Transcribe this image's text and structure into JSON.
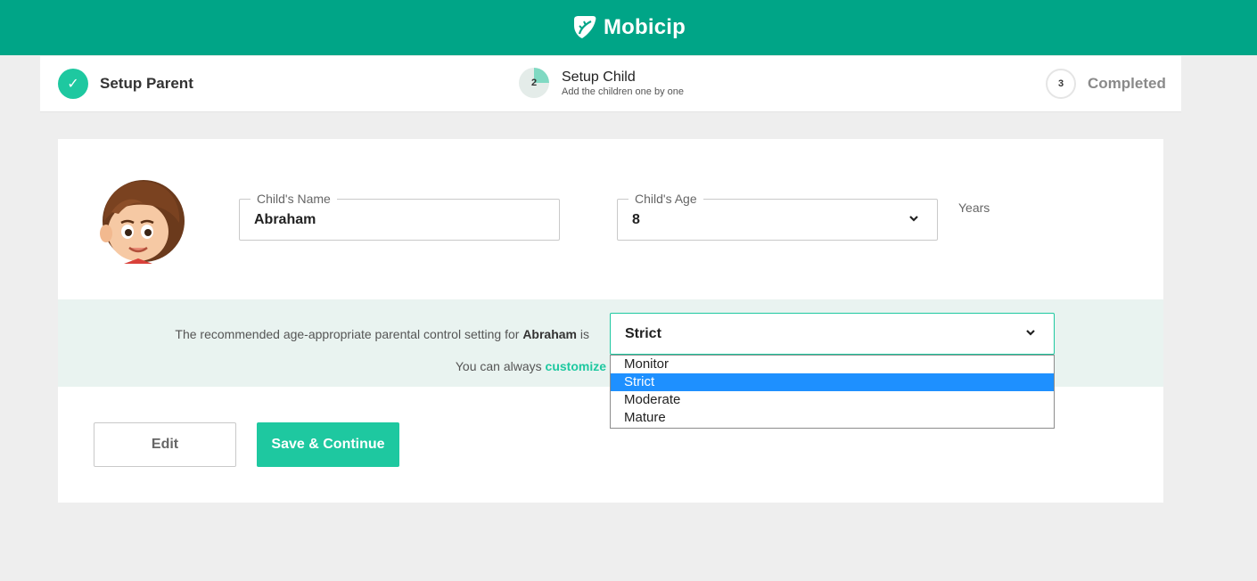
{
  "header": {
    "brand": "Mobicip"
  },
  "steps": [
    {
      "number": "✓",
      "label": "Setup Parent",
      "status": "done"
    },
    {
      "number": "2",
      "label": "Setup Child",
      "subtitle": "Add the children one by one",
      "status": "active",
      "progress": 0.25
    },
    {
      "number": "3",
      "label": "Completed",
      "status": "todo"
    }
  ],
  "child": {
    "name_label": "Child's Name",
    "name_value": "Abraham",
    "age_label": "Child's Age",
    "age_value": "8",
    "age_unit": "Years"
  },
  "recommendation": {
    "text_before": "The recommended age-appropriate parental control setting for ",
    "child_name": "Abraham",
    "text_after": " is",
    "selected_setting": "Strict",
    "customize_prefix": "You can always ",
    "customize_link": "customize"
  },
  "dropdown": {
    "options": [
      "Monitor",
      "Strict",
      "Moderate",
      "Mature"
    ],
    "highlighted": "Strict"
  },
  "buttons": {
    "edit": "Edit",
    "save": "Save & Continue"
  },
  "colors": {
    "brand": "#00a587",
    "accent": "#1ec8a0",
    "highlight": "#1e90ff",
    "band": "#e9f3f0"
  }
}
